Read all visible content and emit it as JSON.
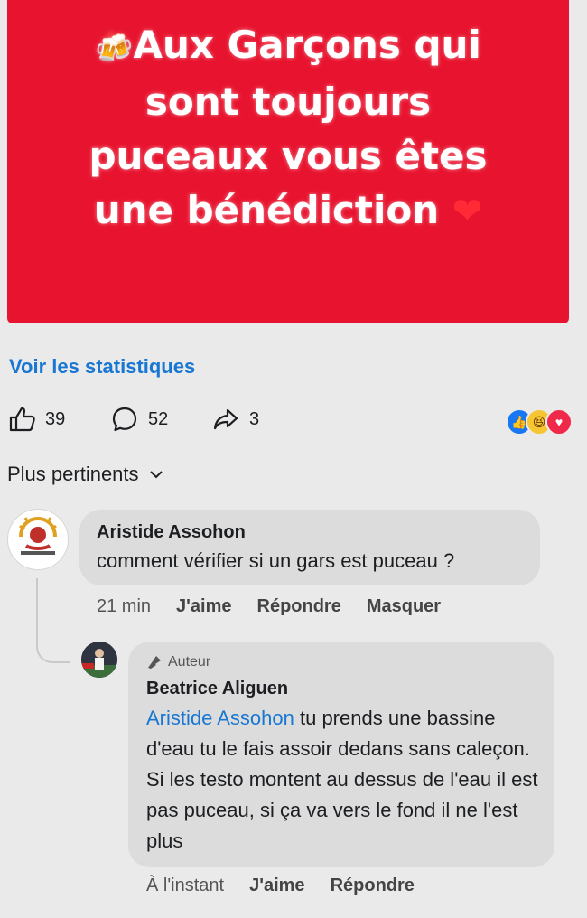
{
  "post": {
    "emoji_beer": "🍻",
    "text": "Aux Garçons qui\nsont toujours\npuceaux  vous êtes\nune bénédiction",
    "emoji_heart": "❤",
    "background": "#e8142f"
  },
  "stats_link": "Voir les statistiques",
  "actions": {
    "likes": "39",
    "comments": "52",
    "shares": "3"
  },
  "sort_label": "Plus pertinents",
  "comments": [
    {
      "name": "Aristide Assohon",
      "text": "comment vérifier si un gars est puceau ?",
      "time": "21 min",
      "like": "J'aime",
      "reply": "Répondre",
      "hide": "Masquer"
    },
    {
      "author_tag": "Auteur",
      "name": "Beatrice Aliguen",
      "mention": "Aristide Assohon",
      "text": " tu prends une bassine d'eau tu le fais assoir dedans sans caleçon. Si les testo montent au dessus de l'eau il est pas puceau, si ça va vers le fond il ne l'est plus",
      "time": "À l'instant",
      "like": "J'aime",
      "reply": "Répondre"
    }
  ],
  "colors": {
    "link": "#1877d2",
    "bubble": "#dcdcdc",
    "background": "#eaeaea"
  }
}
